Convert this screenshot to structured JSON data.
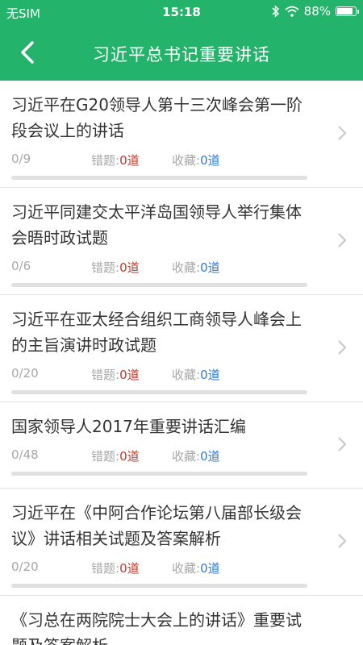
{
  "status_bar": {
    "carrier": "无SIM",
    "time": "15:18",
    "battery_text": "88%",
    "battery_level": 0.88
  },
  "nav": {
    "title": "习近平总书记重要讲话"
  },
  "labels": {
    "wrong": "错题:",
    "favorites": "收藏:"
  },
  "items": [
    {
      "title": "习近平在G20领导人第十三次峰会第一阶段会议上的讲话",
      "progress": "0/9",
      "wrong": "0道",
      "favorites": "0道",
      "progress_fraction": 0
    },
    {
      "title": "习近平同建交太平洋岛国领导人举行集体会晤时政试题",
      "progress": "0/6",
      "wrong": "0道",
      "favorites": "0道",
      "progress_fraction": 0
    },
    {
      "title": "习近平在亚太经合组织工商领导人峰会上的主旨演讲时政试题",
      "progress": "0/20",
      "wrong": "0道",
      "favorites": "0道",
      "progress_fraction": 0
    },
    {
      "title": "国家领导人2017年重要讲话汇编",
      "progress": "0/48",
      "wrong": "0道",
      "favorites": "0道",
      "progress_fraction": 0
    },
    {
      "title": "习近平在《中阿合作论坛第八届部长级会议》讲话相关试题及答案解析",
      "progress": "0/20",
      "wrong": "0道",
      "favorites": "0道",
      "progress_fraction": 0
    },
    {
      "title": "《习总在两院院士大会上的讲话》重要试题及答案解析"
    }
  ],
  "colors": {
    "brand_green": "#24b36b",
    "wrong_red": "#c0392b",
    "favorite_blue": "#2e7bd6"
  }
}
